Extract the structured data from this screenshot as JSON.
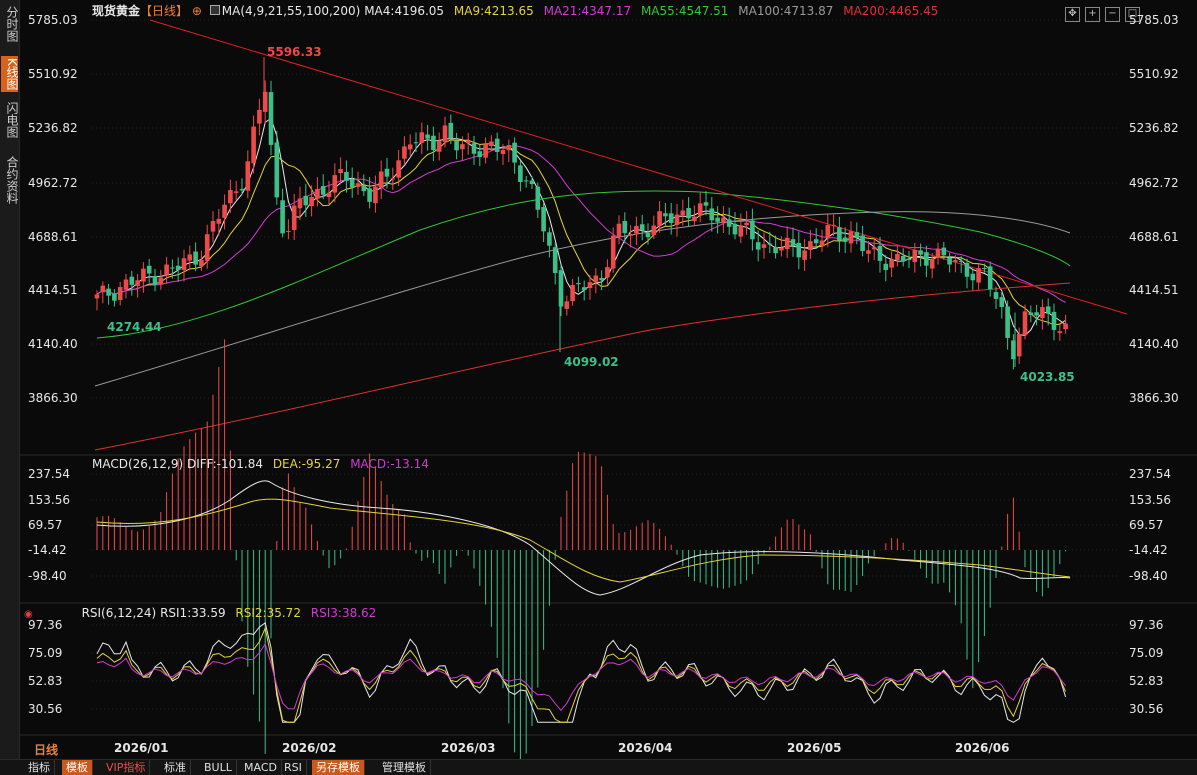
{
  "sidebar": {
    "tabs": [
      {
        "label": "分时图",
        "active": false
      },
      {
        "label": "K线图",
        "active": true
      },
      {
        "label": "闪电图",
        "active": false
      },
      {
        "label": "合约资料",
        "active": false
      }
    ]
  },
  "main_legend": {
    "title": "现货黄金",
    "period": "【日线】",
    "add_icon": "⊕",
    "ma_params": "MA(4,9,21,55,100,200)",
    "items": [
      {
        "text": "MA4:4196.05",
        "color": "#e8e8e8"
      },
      {
        "text": "MA9:4213.65",
        "color": "#e3d43c"
      },
      {
        "text": "MA21:4347.17",
        "color": "#d23ad2"
      },
      {
        "text": "MA55:4547.51",
        "color": "#32c832"
      },
      {
        "text": "MA100:4713.87",
        "color": "#9a9a9a"
      },
      {
        "text": "MA200:4465.45",
        "color": "#e03030"
      }
    ]
  },
  "price_axis": [
    "5785.03",
    "5510.92",
    "5236.82",
    "4962.72",
    "4688.61",
    "4414.51",
    "4140.40",
    "3866.30"
  ],
  "macd_legend": {
    "name": "MACD(26,12,9)",
    "diff": "DIFF:-101.84",
    "dea": "DEA:-95.27",
    "macd": "MACD:-13.14"
  },
  "macd_axis": [
    "237.54",
    "153.56",
    "69.57",
    "-14.42",
    "-98.40"
  ],
  "rsi_legend": {
    "name": "RSI(6,12,24)",
    "rsi1": "RSI1:33.59",
    "rsi2": "RSI2:35.72",
    "rsi3": "RSI3:38.62"
  },
  "rsi_axis": [
    "97.36",
    "75.09",
    "52.83",
    "30.56"
  ],
  "annotations": {
    "high": "5596.33",
    "start_low": "4274.44",
    "mid_low": "4099.02",
    "last_low": "4023.85"
  },
  "x_axis": {
    "period_label": "日线",
    "months": [
      "2026/01",
      "2026/02",
      "2026/03",
      "2026/04",
      "2026/05",
      "2026/06"
    ]
  },
  "bottom_tabs": [
    {
      "label": "指标",
      "highlight": false
    },
    {
      "label": "模板",
      "highlight": true
    },
    {
      "label": "VIP指标",
      "highlight": false
    },
    {
      "label": "标准",
      "highlight": false
    },
    {
      "label": "BULL",
      "highlight": false
    },
    {
      "label": "MACD",
      "highlight": false
    },
    {
      "label": "RSI",
      "highlight": false
    },
    {
      "label": "另存模板",
      "highlight": true
    },
    {
      "label": "管理模板",
      "highlight": false
    }
  ],
  "window_icons": [
    "move-icon",
    "zoom-in-icon",
    "zoom-out-icon",
    "maximize-icon"
  ],
  "colors": {
    "up": "#ef4a4a",
    "down": "#3cc08a",
    "trendline": "#e02020",
    "macd_diff": "#e8e8e8",
    "macd_dea": "#e3d43c",
    "rsi1": "#e8e8e8",
    "rsi2": "#e3d43c",
    "rsi3": "#d23ad2"
  },
  "chart_data": {
    "type": "candlestick",
    "title": "现货黄金 日线",
    "y_range_price": [
      3866.3,
      5785.03
    ],
    "labeled_points": [
      {
        "label": "5596.33",
        "x": "2026/01 late",
        "y": 5596.33
      },
      {
        "label": "4274.44",
        "x": "2026/01 start",
        "y": 4274.44
      },
      {
        "label": "4099.02",
        "x": "2026/03",
        "y": 4099.02
      },
      {
        "label": "4023.85",
        "x": "2026/06",
        "y": 4023.85
      }
    ],
    "macd": {
      "DIFF": -101.84,
      "DEA": -95.27,
      "MACD": -13.14,
      "y_range": [
        -98.4,
        237.54
      ]
    },
    "rsi": {
      "RSI1": 33.59,
      "RSI2": 35.72,
      "RSI3": 38.62,
      "y_range": [
        30.56,
        97.36
      ]
    },
    "x_ticks": [
      "2026/01",
      "2026/02",
      "2026/03",
      "2026/04",
      "2026/05",
      "2026/06"
    ]
  }
}
